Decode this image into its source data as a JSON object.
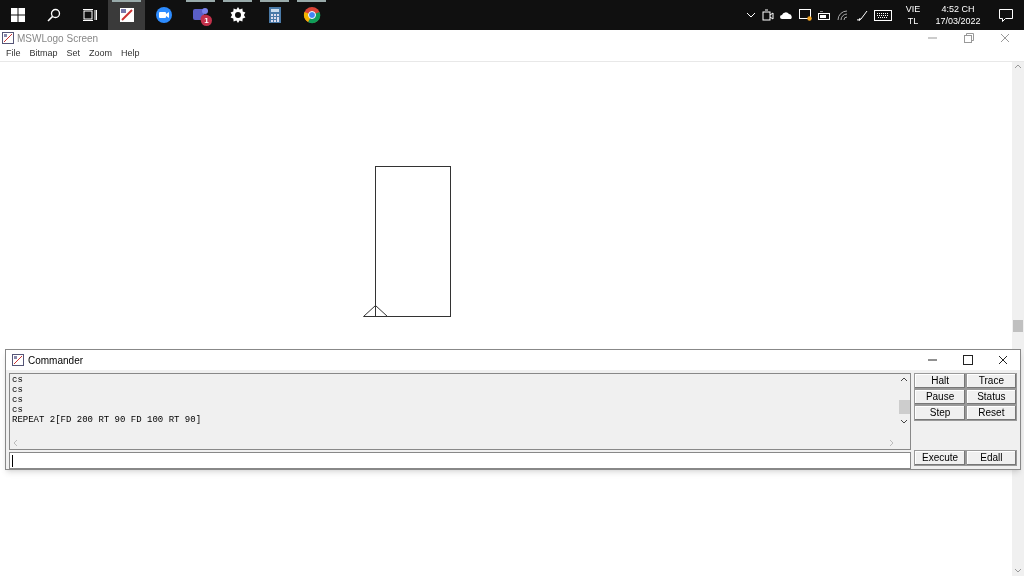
{
  "taskbar": {
    "apps": [
      {
        "running": true,
        "active": true
      },
      {
        "running": false,
        "active": false
      },
      {
        "running": true,
        "active": false,
        "badge": "1"
      },
      {
        "running": true,
        "active": false
      },
      {
        "running": true,
        "active": false
      },
      {
        "running": true,
        "active": false
      }
    ],
    "language": [
      "VIE",
      "TL"
    ],
    "time": "4:52 CH",
    "date": "17/03/2022"
  },
  "window": {
    "title": "MSWLogo Screen",
    "menu": [
      "File",
      "Bitmap",
      "Set",
      "Zoom",
      "Help"
    ]
  },
  "commander": {
    "title": "Commander",
    "output": [
      "cs",
      "cs",
      "cs",
      "cs",
      "REPEAT 2[FD 200 RT 90 FD 100 RT 90]"
    ],
    "buttons": [
      "Halt",
      "Trace",
      "Pause",
      "Status",
      "Step",
      "Reset"
    ],
    "bottom_buttons": [
      "Execute",
      "Edall"
    ]
  }
}
